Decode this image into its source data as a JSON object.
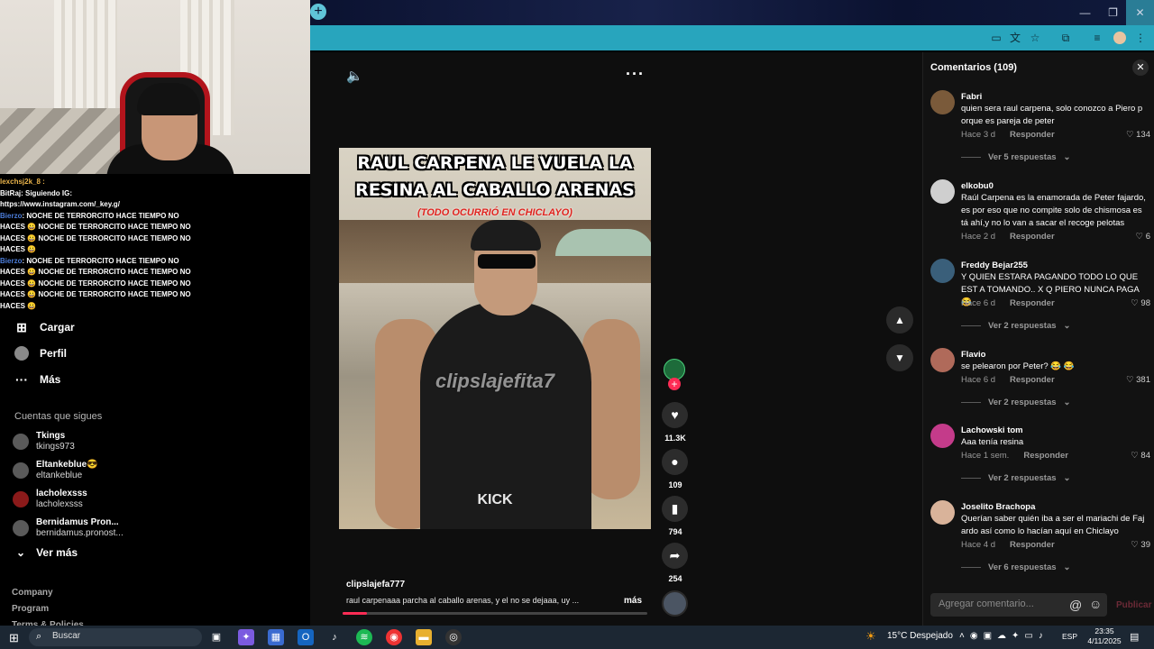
{
  "overlay": {
    "chat": [
      {
        "user": "lexchsj2k_8 :",
        "text": "",
        "user_color": "#e8b24a"
      },
      {
        "user": "",
        "text": "BitRaj: Siguiendo IG:"
      },
      {
        "user": "",
        "text": "https://www.instagram.com/_key.g/"
      },
      {
        "user": "Bierzo",
        "text": ": NOCHE DE TERRORCITO HACE TIEMPO NO"
      },
      {
        "user": "",
        "text": "HACES 😀 NOCHE DE TERRORCITO HACE TIEMPO NO"
      },
      {
        "user": "",
        "text": "HACES 😀 NOCHE DE TERRORCITO HACE TIEMPO NO"
      },
      {
        "user": "",
        "text": "HACES 😀"
      },
      {
        "user": "Bierzo",
        "text": ": NOCHE DE TERRORCITO HACE TIEMPO NO"
      },
      {
        "user": "",
        "text": "HACES 😀 NOCHE DE TERRORCITO HACE TIEMPO NO"
      },
      {
        "user": "",
        "text": "HACES 😀 NOCHE DE TERRORCITO HACE TIEMPO NO"
      },
      {
        "user": "",
        "text": "HACES 😀 NOCHE DE TERRORCITO HACE TIEMPO NO"
      },
      {
        "user": "",
        "text": "HACES 😀"
      }
    ]
  },
  "sidebar": {
    "nav": [
      {
        "label": "Cargar",
        "icon": "plus-square-icon"
      },
      {
        "label": "Perfil",
        "icon": "avatar"
      },
      {
        "label": "Más",
        "icon": "more-dots-icon"
      }
    ],
    "following_title": "Cuentas que sigues",
    "following": [
      {
        "name": "Tkings",
        "handle": "tkings973"
      },
      {
        "name": "Eltankeblue😎",
        "handle": "eltankeblue"
      },
      {
        "name": "lacholexsss",
        "handle": "lacholexsss"
      },
      {
        "name": "Bernidamus Pron...",
        "handle": "bernidamus.pronost..."
      }
    ],
    "see_more": "Ver más",
    "footer": [
      "Company",
      "Program",
      "Terms & Policies"
    ]
  },
  "video": {
    "title_line1": "RAUL CARPENA LE VUELA LA",
    "title_line2": "RESINA AL CABALLO ARENAS",
    "subtitle": "(TODO OCURRIÓ EN CHICLAYO)",
    "watermark": "clipslajefita7",
    "brand": "KICK",
    "author": "clipslajefa777",
    "description": "raul carpenaaa parcha al caballo arenas, y el no se dejaaa, uy ...",
    "more": "más",
    "progress": 0.08,
    "likes": "11.3K",
    "comments": "109",
    "saves": "794",
    "shares": "254"
  },
  "comments": {
    "title": "Comentarios (109)",
    "reply_label": "Responder",
    "input_placeholder": "Agregar comentario...",
    "post_label": "Publicar",
    "items": [
      {
        "name": "Fabri",
        "text": "quien sera raul carpena, solo conozco a Piero p orque es pareja de peter",
        "time": "Hace 3 d",
        "likes": "134",
        "replies": "Ver 5 respuestas"
      },
      {
        "name": "elkobu0",
        "text": "Raúl Carpena es la enamorada de Peter fajardo, es por eso que no compite solo de chismosa es tá ahí,y no lo van a sacar el recoge pelotas",
        "time": "Hace 2 d",
        "likes": "6",
        "replies": ""
      },
      {
        "name": "Freddy Bejar255",
        "text": "Y QUIEN ESTARA PAGANDO TODO LO QUE EST A TOMANDO.. X Q PIERO NUNCA PAGA 😂",
        "time": "Hace 6 d",
        "likes": "98",
        "replies": "Ver 2 respuestas"
      },
      {
        "name": "Flavio",
        "text": "se pelearon por Peter? 😂 😂",
        "time": "Hace 6 d",
        "likes": "381",
        "replies": "Ver 2 respuestas"
      },
      {
        "name": "Lachowski tom",
        "text": "Aaa tenía resina",
        "time": "Hace 1 sem.",
        "likes": "84",
        "replies": "Ver 2 respuestas"
      },
      {
        "name": "Joselito Brachopa",
        "text": "Querían saber quién iba a ser el mariachi de Faj ardo así como lo hacían aquí en Chiclayo",
        "time": "Hace 4 d",
        "likes": "39",
        "replies": "Ver 6 respuestas"
      }
    ]
  },
  "taskbar": {
    "search_placeholder": "Buscar",
    "weather": "15°C  Despejado",
    "lang": "ESP",
    "time": "23:35",
    "date": "4/11/2025"
  },
  "colors": {
    "accent": "#fe2c55",
    "toolbar": "#28a5bd"
  }
}
